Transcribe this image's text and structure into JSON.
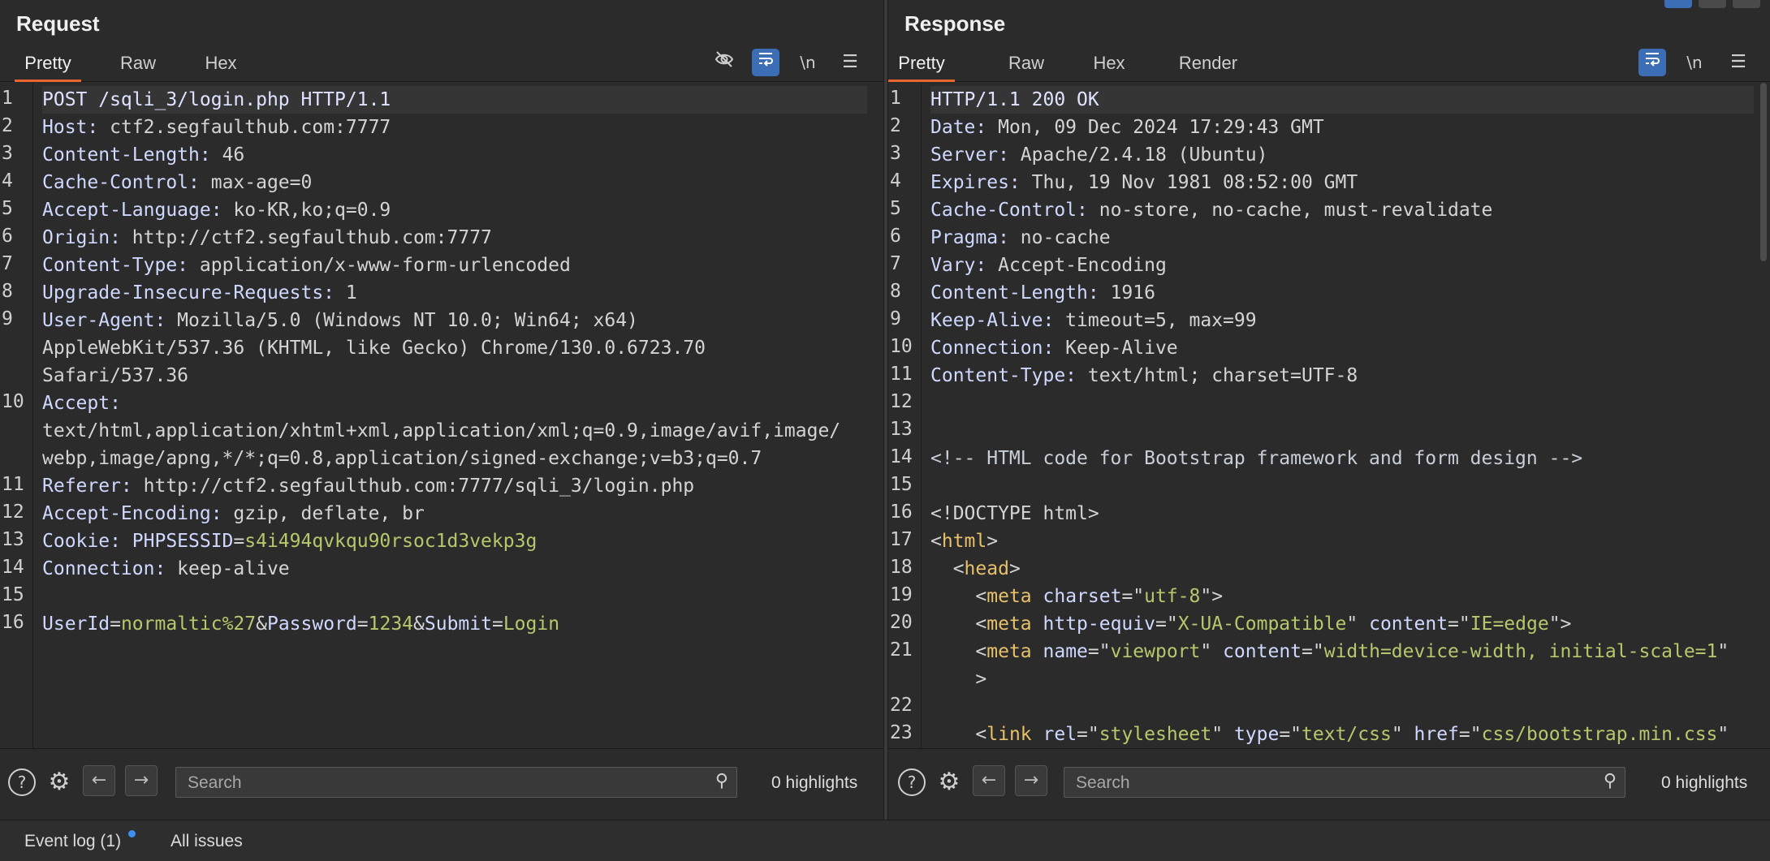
{
  "request": {
    "title": "Request",
    "tabs": [
      "Pretty",
      "Raw",
      "Hex"
    ],
    "active_tab": "Pretty",
    "tools": {
      "hide_icon": "eye-off-icon",
      "wrap_icon": "wrap-icon",
      "newline_label": "\\n",
      "menu_icon": "menu-icon"
    },
    "lines": [
      {
        "n": "1",
        "parts": [
          {
            "c": "kd",
            "t": "POST /sqli_3/login.php HTTP/1.1"
          }
        ]
      },
      {
        "n": "2",
        "parts": [
          {
            "c": "k",
            "t": "Host: "
          },
          {
            "c": "v",
            "t": "ctf2.segfaulthub.com:7777"
          }
        ]
      },
      {
        "n": "3",
        "parts": [
          {
            "c": "k",
            "t": "Content-Length: "
          },
          {
            "c": "v",
            "t": "46"
          }
        ]
      },
      {
        "n": "4",
        "parts": [
          {
            "c": "k",
            "t": "Cache-Control: "
          },
          {
            "c": "v",
            "t": "max-age=0"
          }
        ]
      },
      {
        "n": "5",
        "parts": [
          {
            "c": "k",
            "t": "Accept-Language: "
          },
          {
            "c": "v",
            "t": "ko-KR,ko;q=0.9"
          }
        ]
      },
      {
        "n": "6",
        "parts": [
          {
            "c": "k",
            "t": "Origin: "
          },
          {
            "c": "v",
            "t": "http://ctf2.segfaulthub.com:7777"
          }
        ]
      },
      {
        "n": "7",
        "parts": [
          {
            "c": "k",
            "t": "Content-Type: "
          },
          {
            "c": "v",
            "t": "application/x-www-form-urlencoded"
          }
        ]
      },
      {
        "n": "8",
        "parts": [
          {
            "c": "k",
            "t": "Upgrade-Insecure-Requests: "
          },
          {
            "c": "v",
            "t": "1"
          }
        ]
      },
      {
        "n": "9",
        "parts": [
          {
            "c": "k",
            "t": "User-Agent: "
          },
          {
            "c": "v",
            "t": "Mozilla/5.0 (Windows NT 10.0; Win64; x64)"
          }
        ]
      },
      {
        "n": "",
        "parts": [
          {
            "c": "v",
            "t": "AppleWebKit/537.36 (KHTML, like Gecko) Chrome/130.0.6723.70"
          }
        ]
      },
      {
        "n": "",
        "parts": [
          {
            "c": "v",
            "t": "Safari/537.36"
          }
        ]
      },
      {
        "n": "10",
        "parts": [
          {
            "c": "k",
            "t": "Accept:"
          }
        ]
      },
      {
        "n": "",
        "parts": [
          {
            "c": "v",
            "t": "text/html,application/xhtml+xml,application/xml;q=0.9,image/avif,image/"
          }
        ]
      },
      {
        "n": "",
        "parts": [
          {
            "c": "v",
            "t": "webp,image/apng,*/*;q=0.8,application/signed-exchange;v=b3;q=0.7"
          }
        ]
      },
      {
        "n": "11",
        "parts": [
          {
            "c": "k",
            "t": "Referer: "
          },
          {
            "c": "v",
            "t": "http://ctf2.segfaulthub.com:7777/sqli_3/login.php"
          }
        ]
      },
      {
        "n": "12",
        "parts": [
          {
            "c": "k",
            "t": "Accept-Encoding: "
          },
          {
            "c": "v",
            "t": "gzip, deflate, br"
          }
        ]
      },
      {
        "n": "13",
        "parts": [
          {
            "c": "k",
            "t": "Cookie: "
          },
          {
            "c": "a",
            "t": "PHPSESSID"
          },
          {
            "c": "v",
            "t": "="
          },
          {
            "c": "g",
            "t": "s4i494qvkqu90rsoc1d3vekp3g"
          }
        ]
      },
      {
        "n": "14",
        "parts": [
          {
            "c": "k",
            "t": "Connection: "
          },
          {
            "c": "v",
            "t": "keep-alive"
          }
        ]
      },
      {
        "n": "15",
        "parts": []
      },
      {
        "n": "16",
        "parts": [
          {
            "c": "a",
            "t": "UserId"
          },
          {
            "c": "v",
            "t": "="
          },
          {
            "c": "g",
            "t": "normaltic%27"
          },
          {
            "c": "v",
            "t": "&"
          },
          {
            "c": "a",
            "t": "Password"
          },
          {
            "c": "v",
            "t": "="
          },
          {
            "c": "g",
            "t": "1234"
          },
          {
            "c": "v",
            "t": "&"
          },
          {
            "c": "a",
            "t": "Submit"
          },
          {
            "c": "v",
            "t": "="
          },
          {
            "c": "g",
            "t": "Login"
          }
        ]
      }
    ],
    "search_placeholder": "Search",
    "highlights": "0 highlights"
  },
  "response": {
    "title": "Response",
    "tabs": [
      "Pretty",
      "Raw",
      "Hex",
      "Render"
    ],
    "active_tab": "Pretty",
    "tools": {
      "wrap_icon": "wrap-icon",
      "newline_label": "\\n",
      "menu_icon": "menu-icon"
    },
    "lines": [
      {
        "n": "1",
        "parts": [
          {
            "c": "kd",
            "t": "HTTP/1.1 200 OK"
          }
        ]
      },
      {
        "n": "2",
        "parts": [
          {
            "c": "k",
            "t": "Date: "
          },
          {
            "c": "v",
            "t": "Mon, 09 Dec 2024 17:29:43 GMT"
          }
        ]
      },
      {
        "n": "3",
        "parts": [
          {
            "c": "k",
            "t": "Server: "
          },
          {
            "c": "v",
            "t": "Apache/2.4.18 (Ubuntu)"
          }
        ]
      },
      {
        "n": "4",
        "parts": [
          {
            "c": "k",
            "t": "Expires: "
          },
          {
            "c": "v",
            "t": "Thu, 19 Nov 1981 08:52:00 GMT"
          }
        ]
      },
      {
        "n": "5",
        "parts": [
          {
            "c": "k",
            "t": "Cache-Control: "
          },
          {
            "c": "v",
            "t": "no-store, no-cache, must-revalidate"
          }
        ]
      },
      {
        "n": "6",
        "parts": [
          {
            "c": "k",
            "t": "Pragma: "
          },
          {
            "c": "v",
            "t": "no-cache"
          }
        ]
      },
      {
        "n": "7",
        "parts": [
          {
            "c": "k",
            "t": "Vary: "
          },
          {
            "c": "v",
            "t": "Accept-Encoding"
          }
        ]
      },
      {
        "n": "8",
        "parts": [
          {
            "c": "k",
            "t": "Content-Length: "
          },
          {
            "c": "v",
            "t": "1916"
          }
        ]
      },
      {
        "n": "9",
        "parts": [
          {
            "c": "k",
            "t": "Keep-Alive: "
          },
          {
            "c": "v",
            "t": "timeout=5, max=99"
          }
        ]
      },
      {
        "n": "10",
        "parts": [
          {
            "c": "k",
            "t": "Connection: "
          },
          {
            "c": "v",
            "t": "Keep-Alive"
          }
        ]
      },
      {
        "n": "11",
        "parts": [
          {
            "c": "k",
            "t": "Content-Type: "
          },
          {
            "c": "v",
            "t": "text/html; charset=UTF-8"
          }
        ]
      },
      {
        "n": "12",
        "parts": []
      },
      {
        "n": "13",
        "parts": []
      },
      {
        "n": "14",
        "parts": [
          {
            "c": "c",
            "t": "<!-- HTML code for Bootstrap framework and form design -->"
          }
        ]
      },
      {
        "n": "15",
        "parts": []
      },
      {
        "n": "16",
        "parts": [
          {
            "c": "v",
            "t": "<!DOCTYPE html>"
          }
        ]
      },
      {
        "n": "17",
        "parts": [
          {
            "c": "v",
            "t": "<"
          },
          {
            "c": "t",
            "t": "html"
          },
          {
            "c": "v",
            "t": ">"
          }
        ]
      },
      {
        "n": "18",
        "parts": [
          {
            "c": "v",
            "t": "  <"
          },
          {
            "c": "t",
            "t": "head"
          },
          {
            "c": "v",
            "t": ">"
          }
        ]
      },
      {
        "n": "19",
        "parts": [
          {
            "c": "v",
            "t": "    <"
          },
          {
            "c": "t",
            "t": "meta "
          },
          {
            "c": "a",
            "t": "charset"
          },
          {
            "c": "v",
            "t": "=\""
          },
          {
            "c": "s",
            "t": "utf-8"
          },
          {
            "c": "v",
            "t": "\">"
          }
        ]
      },
      {
        "n": "20",
        "parts": [
          {
            "c": "v",
            "t": "    <"
          },
          {
            "c": "t",
            "t": "meta "
          },
          {
            "c": "a",
            "t": "http-equiv"
          },
          {
            "c": "v",
            "t": "=\""
          },
          {
            "c": "s",
            "t": "X-UA-Compatible"
          },
          {
            "c": "v",
            "t": "\" "
          },
          {
            "c": "a",
            "t": "content"
          },
          {
            "c": "v",
            "t": "=\""
          },
          {
            "c": "s",
            "t": "IE=edge"
          },
          {
            "c": "v",
            "t": "\">"
          }
        ]
      },
      {
        "n": "21",
        "parts": [
          {
            "c": "v",
            "t": "    <"
          },
          {
            "c": "t",
            "t": "meta "
          },
          {
            "c": "a",
            "t": "name"
          },
          {
            "c": "v",
            "t": "=\""
          },
          {
            "c": "s",
            "t": "viewport"
          },
          {
            "c": "v",
            "t": "\" "
          },
          {
            "c": "a",
            "t": "content"
          },
          {
            "c": "v",
            "t": "=\""
          },
          {
            "c": "s",
            "t": "width=device-width, initial-scale=1"
          },
          {
            "c": "v",
            "t": "\""
          }
        ]
      },
      {
        "n": "",
        "parts": [
          {
            "c": "v",
            "t": "    >"
          }
        ]
      },
      {
        "n": "22",
        "parts": []
      },
      {
        "n": "23",
        "parts": [
          {
            "c": "v",
            "t": "    <"
          },
          {
            "c": "t",
            "t": "link "
          },
          {
            "c": "a",
            "t": "rel"
          },
          {
            "c": "v",
            "t": "=\""
          },
          {
            "c": "s",
            "t": "stylesheet"
          },
          {
            "c": "v",
            "t": "\" "
          },
          {
            "c": "a",
            "t": "type"
          },
          {
            "c": "v",
            "t": "=\""
          },
          {
            "c": "s",
            "t": "text/css"
          },
          {
            "c": "v",
            "t": "\" "
          },
          {
            "c": "a",
            "t": "href"
          },
          {
            "c": "v",
            "t": "=\""
          },
          {
            "c": "s",
            "t": "css/bootstrap.min.css"
          },
          {
            "c": "v",
            "t": "\""
          }
        ]
      }
    ],
    "search_placeholder": "Search",
    "highlights": "0 highlights"
  },
  "statusbar": {
    "event_log": "Event log (1)",
    "all_issues": "All issues"
  },
  "colors": {
    "accent": "#e8662e",
    "active_tool": "#3b6eb4",
    "notify_dot": "#3d8ef0",
    "bg": "#2b2b2b"
  }
}
